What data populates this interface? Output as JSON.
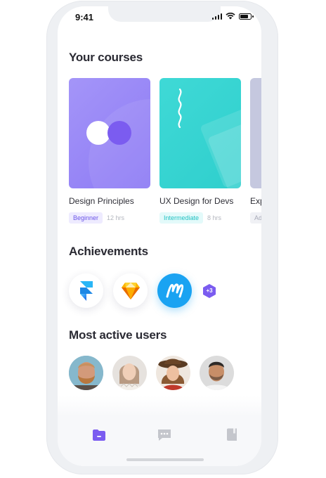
{
  "status_bar": {
    "time": "9:41"
  },
  "sections": {
    "courses_title": "Your courses",
    "achievements_title": "Achievements",
    "users_title": "Most active users"
  },
  "courses": [
    {
      "title": "Design Principles",
      "level": "Beginner",
      "duration": "12 hrs",
      "color": "#8f7cf6",
      "level_bg": "#eeebff",
      "level_color": "#6b55e8"
    },
    {
      "title": "UX Design for Devs",
      "level": "Intermediate",
      "duration": "8 hrs",
      "color": "#34d4d2",
      "level_bg": "#e3fafa",
      "level_color": "#22c1c3"
    },
    {
      "title": "Explor",
      "level": "Advan",
      "duration": "",
      "color": "#c8cbe0",
      "level_bg": "#f0f1f5",
      "level_color": "#a6a9b6"
    }
  ],
  "achievements": {
    "items": [
      "framer-icon",
      "sketch-icon",
      "marvel-icon"
    ],
    "more_count": "+3",
    "more_color": "#7b5cf0"
  },
  "users": [
    {
      "name": "user-1"
    },
    {
      "name": "user-2"
    },
    {
      "name": "user-3"
    },
    {
      "name": "user-4"
    }
  ],
  "tabbar": {
    "tabs": [
      "courses-tab",
      "messages-tab",
      "bookmarks-tab"
    ],
    "active_color": "#7b5cf0",
    "inactive_color": "#c4c6cc"
  }
}
